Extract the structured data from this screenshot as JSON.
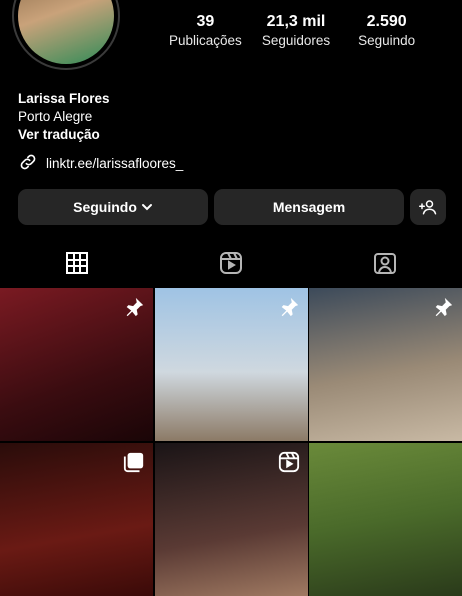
{
  "profile": {
    "name": "Larissa Flores",
    "location": "Porto Alegre",
    "translate_label": "Ver tradução",
    "link": "linktr.ee/larissafloores_"
  },
  "stats": [
    {
      "value": "39",
      "label": "Publicações"
    },
    {
      "value": "21,3 mil",
      "label": "Seguidores"
    },
    {
      "value": "2.590",
      "label": "Seguindo"
    }
  ],
  "actions": {
    "following_label": "Seguindo",
    "message_label": "Mensagem"
  },
  "tabs": [
    {
      "icon": "grid-icon",
      "active": true
    },
    {
      "icon": "reels-icon",
      "active": false
    },
    {
      "icon": "tagged-icon",
      "active": false
    }
  ],
  "posts": [
    {
      "badge": "pin-icon"
    },
    {
      "badge": "pin-icon"
    },
    {
      "badge": "pin-icon"
    },
    {
      "badge": "carousel-icon"
    },
    {
      "badge": "reels-icon"
    },
    {
      "badge": ""
    }
  ]
}
